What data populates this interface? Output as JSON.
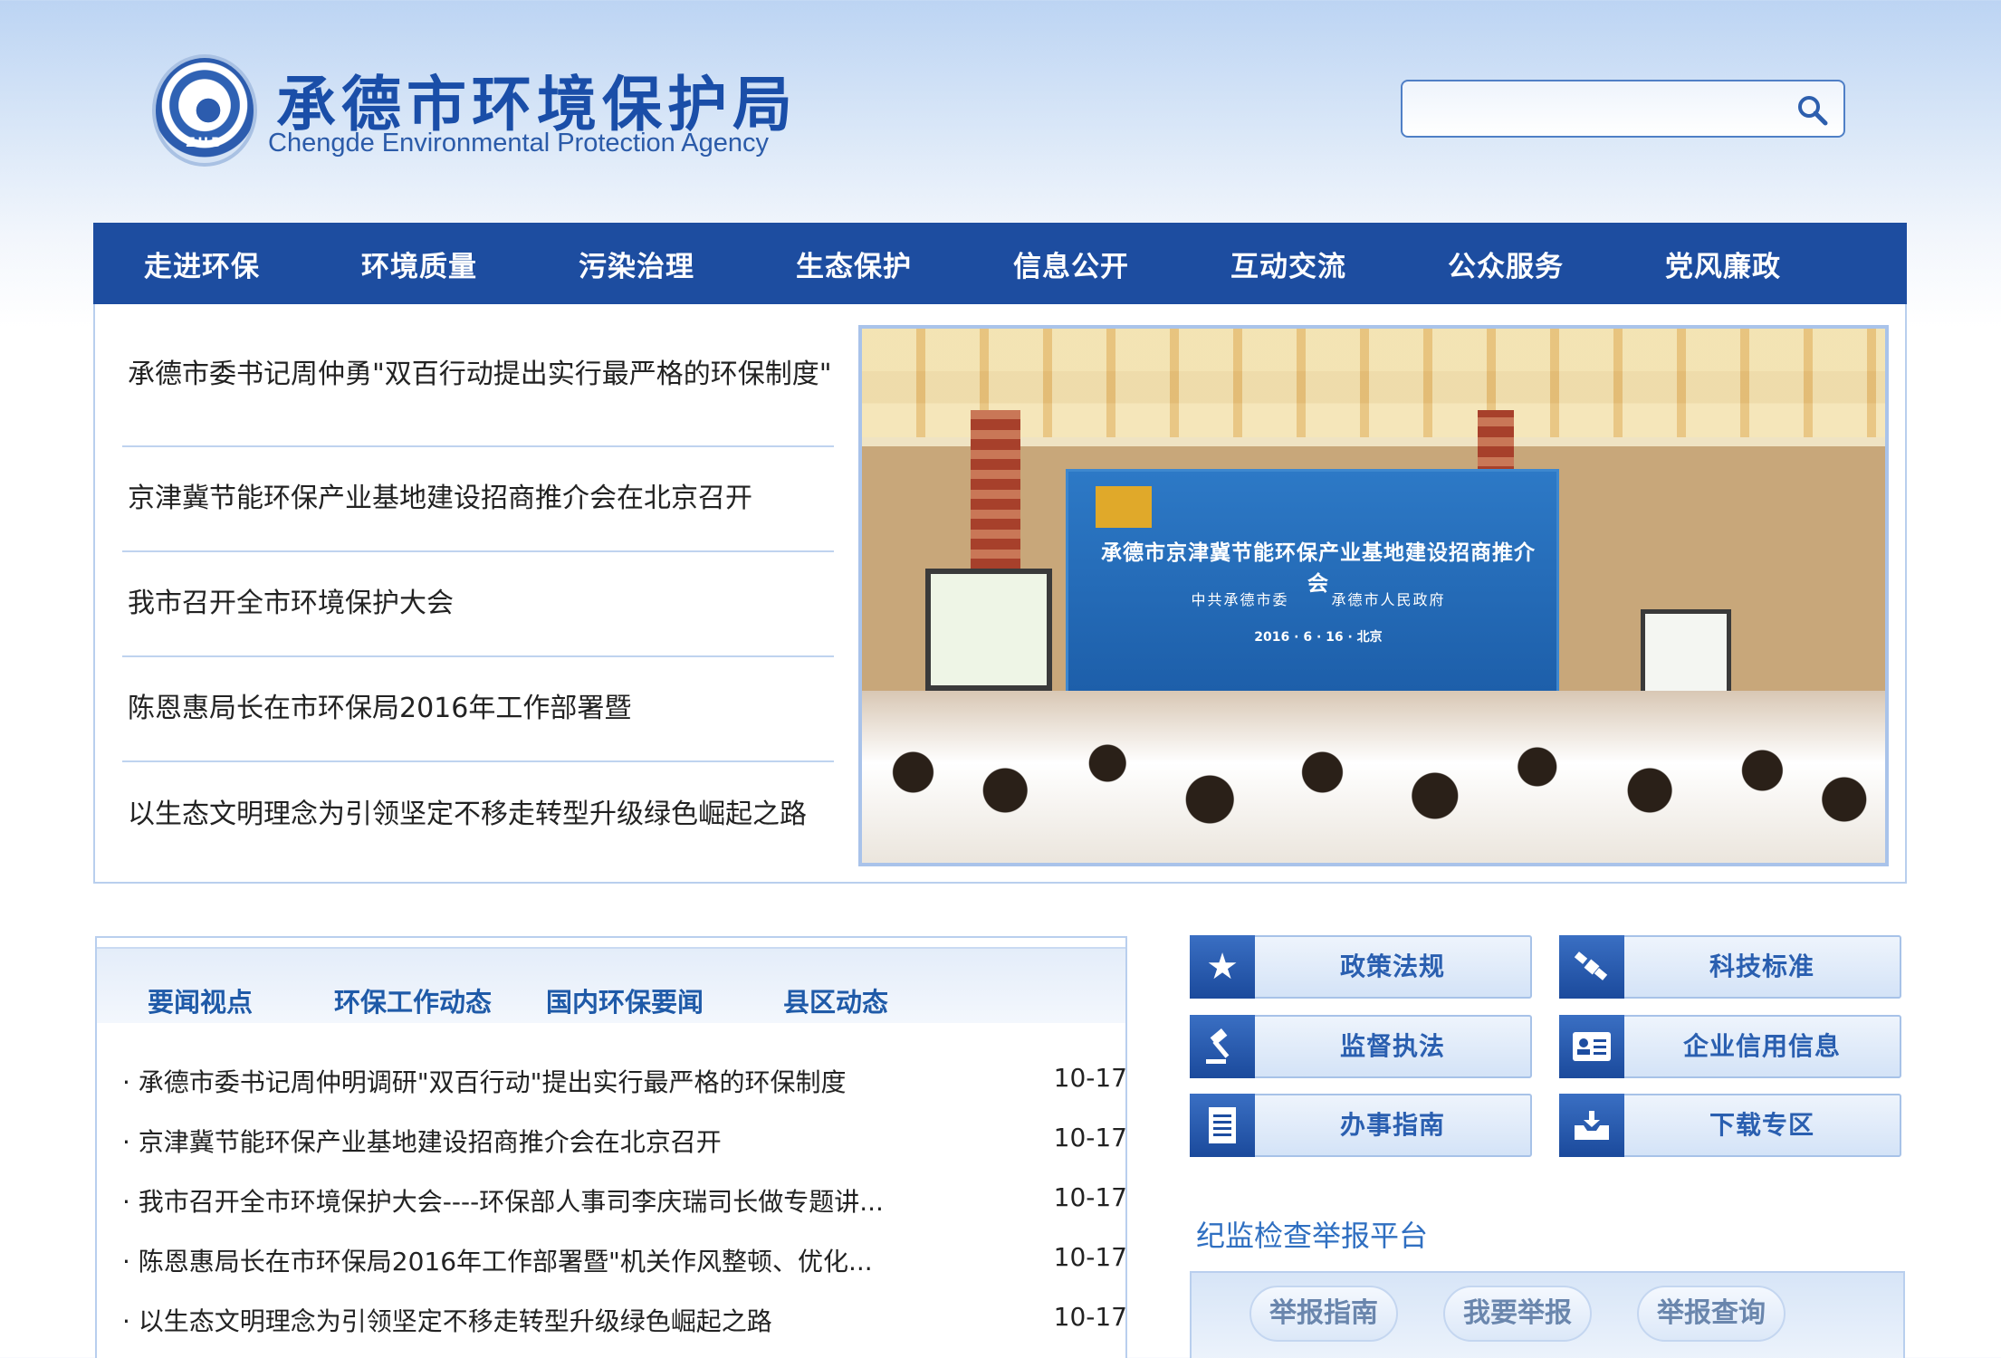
{
  "header": {
    "title": "承德市环境保护局",
    "subtitle": "Chengde Environmental Protection Agency",
    "emblem_text": "ZHB",
    "search_placeholder": ""
  },
  "nav": [
    "走进环保",
    "环境质量",
    "污染治理",
    "生态保护",
    "信息公开",
    "互动交流",
    "公众服务",
    "党风廉政"
  ],
  "headlines": [
    "承德市委书记周仲勇\"双百行动提出实行最严格的环保制度\"",
    "京津冀节能环保产业基地建设招商推介会在北京召开",
    "我市召开全市环境保护大会",
    "陈恩惠局长在市环保局2016年工作部署暨",
    "以生态文明理念为引领坚定不移走转型升级绿色崛起之路"
  ],
  "photo": {
    "banner_title": "承德市京津冀节能环保产业基地建设招商推介会",
    "banner_orgs": "中共承德市委 承德市人民政府",
    "banner_date": "2016 · 6 · 16 · 北京"
  },
  "news_tabs": [
    "要闻视点",
    "环保工作动态",
    "国内环保要闻",
    "县区动态"
  ],
  "news": [
    {
      "title": "· 承德市委书记周仲明调研\"双百行动\"提出实行最严格的环保制度",
      "date": "10-17"
    },
    {
      "title": "· 京津冀节能环保产业基地建设招商推介会在北京召开",
      "date": "10-17"
    },
    {
      "title": "· 我市召开全市环境保护大会----环保部人事司李庆瑞司长做专题讲...",
      "date": "10-17"
    },
    {
      "title": "· 陈恩惠局长在市环保局2016年工作部署暨\"机关作风整顿、优化...",
      "date": "10-17"
    },
    {
      "title": "· 以生态文明理念为引领坚定不移走转型升级绿色崛起之路",
      "date": "10-17"
    }
  ],
  "quick_links": [
    {
      "label": "政策法规",
      "icon": "star-icon"
    },
    {
      "label": "科技标准",
      "icon": "satellite-icon"
    },
    {
      "label": "监督执法",
      "icon": "gavel-icon"
    },
    {
      "label": "企业信用信息",
      "icon": "id-card-icon"
    },
    {
      "label": "办事指南",
      "icon": "document-icon"
    },
    {
      "label": "下载专区",
      "icon": "download-tray-icon"
    }
  ],
  "report": {
    "title": "纪监检查举报平台",
    "buttons": [
      "举报指南",
      "我要举报",
      "举报查询"
    ]
  },
  "colors": {
    "nav_bg": "#1d4da0",
    "accent": "#1f5aa8",
    "border": "#b9cfee"
  }
}
